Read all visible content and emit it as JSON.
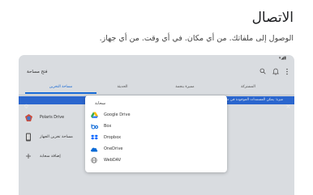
{
  "hero": {
    "title": "الاتصال",
    "subtitle": "الوصول إلى ملفاتك. من أي مكان. في أي وقت. من أي جهاز."
  },
  "app": {
    "title": "فتح مساحة",
    "tabs": [
      {
        "label": "مساحة التخزين",
        "active": true
      },
      {
        "label": "الحديثة",
        "active": false
      },
      {
        "label": "مميزة بنجمة",
        "active": false
      },
      {
        "label": "المشتركة",
        "active": false
      }
    ],
    "banner_text": "ميزة: يمكن المستندات الموجودة في مواقع التخزين السحابي على قرص ...",
    "sidebar": [
      {
        "label": "Polaris Drive",
        "icon": "polaris-drive-icon"
      },
      {
        "label": "مساحة تخزين الجهاز",
        "icon": "phone-icon"
      },
      {
        "label": "إضافة سحابة",
        "icon": "plus-icon"
      }
    ]
  },
  "dialog": {
    "title": "سحابة",
    "options": [
      {
        "label": "Google Drive",
        "icon": "google-drive-icon"
      },
      {
        "label": "Box",
        "icon": "box-icon"
      },
      {
        "label": "Dropbox",
        "icon": "dropbox-icon"
      },
      {
        "label": "OneDrive",
        "icon": "onedrive-icon"
      },
      {
        "label": "WebDAV",
        "icon": "globe-icon"
      }
    ]
  },
  "colors": {
    "accent": "#1a73e8",
    "banner": "#2f6fe0",
    "tablet_bg": "#eceff3"
  }
}
